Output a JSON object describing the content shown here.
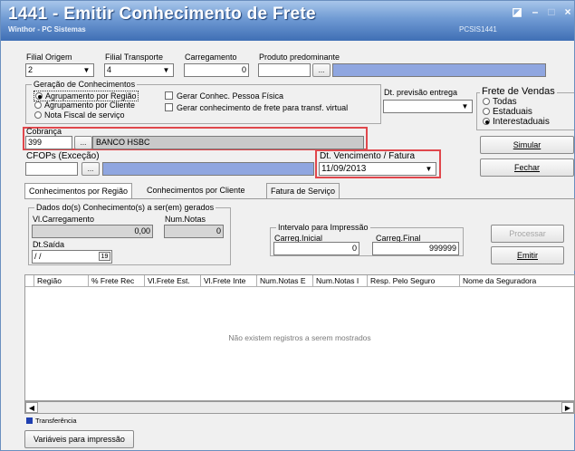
{
  "window": {
    "title": "1441 - Emitir Conhecimento de Frete",
    "company": "Winthor - PC Sistemas",
    "code": "PCSIS1441"
  },
  "fields": {
    "filial_origem": {
      "label": "Filial Origem",
      "value": "2"
    },
    "filial_transporte": {
      "label": "Filial Transporte",
      "value": "4"
    },
    "carregamento": {
      "label": "Carregamento",
      "value": "0"
    },
    "produto_predominante": {
      "label": "Produto predominante",
      "value": "",
      "button": "..."
    },
    "dt_previsao": {
      "label": "Dt. previsão entrega",
      "value": ""
    },
    "cobranca": {
      "label": "Cobrança",
      "code": "399",
      "button": "...",
      "name": "BANCO HSBC"
    },
    "cfops": {
      "label": "CFOPs  (Exceção)",
      "value": "",
      "button": "..."
    },
    "dt_vencimento": {
      "label": "Dt. Vencimento / Fatura",
      "value": "11/09/2013"
    }
  },
  "geracao": {
    "title": "Geração de Conhecimentos",
    "radios": [
      {
        "label": "Agrupamento por Região",
        "selected": true
      },
      {
        "label": "Agrupamento por Cliente",
        "selected": false
      },
      {
        "label": "Nota Fiscal de serviço",
        "selected": false
      }
    ],
    "checks": [
      {
        "label": "Gerar Conhec. Pessoa Física",
        "checked": false
      },
      {
        "label": "Gerar conhecimento de frete para transf. virtual",
        "checked": false
      }
    ]
  },
  "frete_vendas": {
    "title": "Frete de Vendas",
    "options": [
      {
        "label": "Todas",
        "selected": false
      },
      {
        "label": "Estaduais",
        "selected": false
      },
      {
        "label": "Interestaduais",
        "selected": true
      }
    ]
  },
  "buttons": {
    "simular": "Simular",
    "fechar": "Fechar",
    "processar": "Processar",
    "emitir": "Emitir",
    "variaveis": "Variáveis para impressão"
  },
  "tabs": [
    {
      "label": "Conhecimentos por Região",
      "active": true
    },
    {
      "label": "Conhecimentos por Cliente",
      "active": false
    },
    {
      "label": "Fatura de Serviço",
      "active": false
    }
  ],
  "dados": {
    "title": "Dados do(s) Conhecimento(s) a ser(em) gerados",
    "vl_carregamento_label": "Vl.Carregamento",
    "vl_carregamento": "0,00",
    "num_notas_label": "Num.Notas",
    "num_notas": "0",
    "dt_saida_label": "Dt.Saída",
    "dt_saida": " / /",
    "calendar_icon": "calendar-icon",
    "intervalo_title": "Intervalo para Impressão",
    "carreg_inicial_label": "Carreg.Inicial",
    "carreg_inicial": "0",
    "carreg_final_label": "Carreg.Final",
    "carreg_final": "999999"
  },
  "grid": {
    "columns": [
      "Região",
      "% Frete Rec",
      "Vl.Frete Est.",
      "Vl.Frete Inte",
      "Num.Notas E",
      "Num.Notas I",
      "Resp. Pelo Seguro",
      "Nome da Seguradora"
    ],
    "empty_message": "Não existem registros a serem mostrados"
  },
  "legend": {
    "label": "Transferência",
    "color": "#1f3fb0"
  },
  "colors": {
    "highlight": "#e0474c",
    "title_bar": "#3f6fb5",
    "blue_field": "#8fa6e0"
  }
}
